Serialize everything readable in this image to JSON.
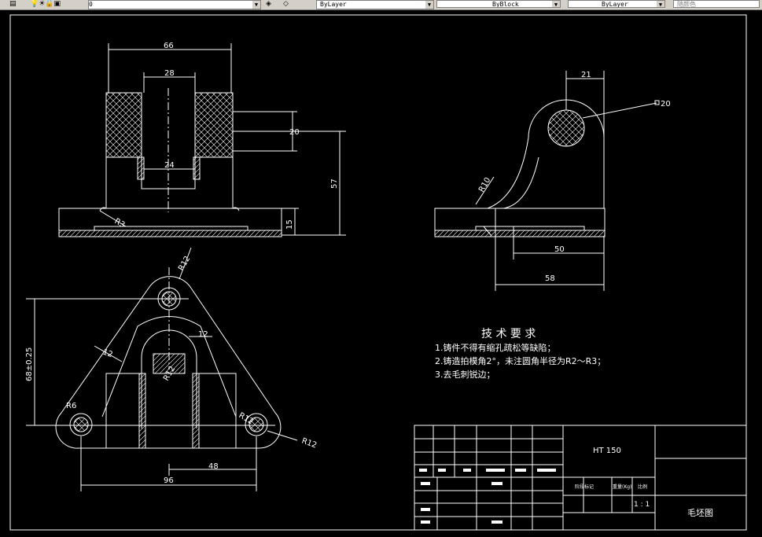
{
  "toolbar": {
    "layer_name": "0",
    "color": "ByLayer",
    "linetype": "ByBlock",
    "lineweight": "ByLayer",
    "plotstyle": "随颜色"
  },
  "drawing": {
    "front_view": {
      "dims": {
        "w66": "66",
        "w28": "28",
        "w24": "24",
        "h20": "20",
        "h57": "57",
        "h15": "15",
        "r3": "R3"
      }
    },
    "side_view": {
      "dims": {
        "w21": "21",
        "d20": "20",
        "r10": "R10",
        "w50": "50",
        "w58": "58"
      }
    },
    "top_view": {
      "dims": {
        "r12_top": "R12",
        "d68": "68±0.25",
        "d12a": "12",
        "d12b": "12",
        "r12_mid": "R12",
        "r6": "R6",
        "r12_right": "R12",
        "r12_far": "R12",
        "w48": "48",
        "w96": "96"
      }
    },
    "tech_requirements": {
      "title": "技 术 要 求",
      "items": [
        "1.铸件不得有缩孔疏松等缺陷；",
        "2.铸造拍模角2°，未注圆角半径为R2～R3；",
        "3.去毛刺锐边；"
      ]
    },
    "title_block": {
      "material": "HT 150",
      "stage_label": "阶段标记",
      "weight_label": "重量(Kg)",
      "scale_label": "比例",
      "scale": "1 : 1",
      "drawing_name": "毛坯图"
    }
  }
}
